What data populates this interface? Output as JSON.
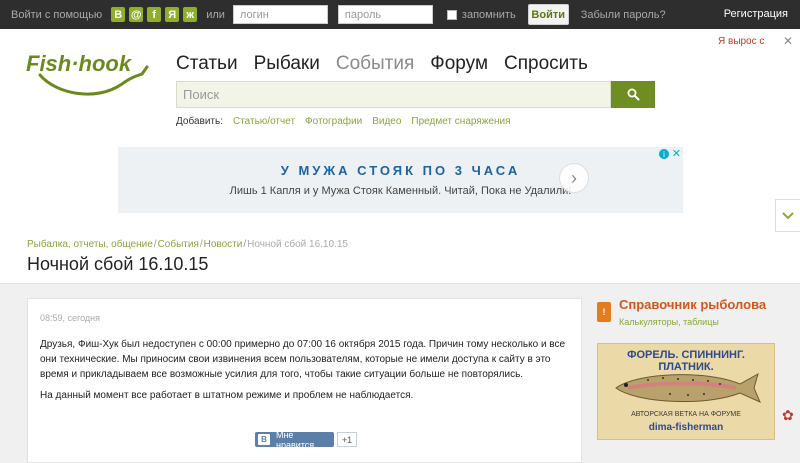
{
  "topbar": {
    "login_via": "Войти с помощью",
    "social": [
      {
        "icon": "vk-icon",
        "glyph": "B"
      },
      {
        "icon": "odnoklassniki-icon",
        "glyph": "@"
      },
      {
        "icon": "facebook-icon",
        "glyph": "f"
      },
      {
        "icon": "yandex-icon",
        "glyph": "Я"
      },
      {
        "icon": "ok-icon",
        "glyph": "ж"
      }
    ],
    "or": "или",
    "login_placeholder": "логин",
    "password_placeholder": "пароль",
    "remember": "запомнить",
    "login_button": "Войти",
    "forgot": "Забыли пароль?",
    "register": "Регистрация"
  },
  "logo": {
    "text": "Fish·hook"
  },
  "promo": {
    "text": "Я вырос с",
    "close": "✕"
  },
  "nav": [
    "Статьи",
    "Рыбаки",
    "События",
    "Форум",
    "Спросить"
  ],
  "nav_active": "События",
  "search": {
    "placeholder": "Поиск"
  },
  "add": {
    "label": "Добавить:",
    "links": [
      "Статью/отчет",
      "Фотографии",
      "Видео",
      "Предмет снаряжения"
    ]
  },
  "ad": {
    "headline": "У МУЖА СТОЯК ПО 3 ЧАСА",
    "subline": "Лишь 1 Капля и у Мужа Стояк Каменный. Читай, Пока не Удалили!",
    "arrow": "›",
    "info": "i",
    "close": "✕"
  },
  "breadcrumbs": {
    "items": [
      "Рыбалка, отчеты, общение",
      "События",
      "Новости"
    ],
    "separator": "/",
    "current": "Ночной сбой 16.10.15"
  },
  "page_title": "Ночной сбой 16.10.15",
  "post": {
    "time": "08:59, сегодня",
    "paragraph1": "Друзья, Фиш-Хук был недоступен с 00:00 примерно до 07:00 16 октября 2015 года. Причин тому несколько и все они технические. Мы приносим свои извинения всем пользователям, которые не имели доступа к сайту в это время и прикладываем все возможные усилия для того, чтобы такие ситуации больше не повторялись.",
    "paragraph2": "На данный момент все работает в штатном режиме и проблем не наблюдается.",
    "like_label": "Мне нравится",
    "like_count": "+1"
  },
  "sidebar": {
    "title": "Справочник рыболова",
    "subtitle": "Калькуляторы, таблицы",
    "banner": {
      "title": "ФОРЕЛЬ. СПИННИНГ. ПЛАТНИК.",
      "foot1": "АВТОРСКАЯ ВЕТКА НА ФОРУМЕ",
      "foot2": "dima-fisherman"
    }
  },
  "colors": {
    "brand_green": "#6e8d22",
    "link_green": "#8aa53a",
    "accent_orange": "#d4561c",
    "topbar_bg": "#2e2e2e",
    "ad_blue": "#1b63a3"
  }
}
